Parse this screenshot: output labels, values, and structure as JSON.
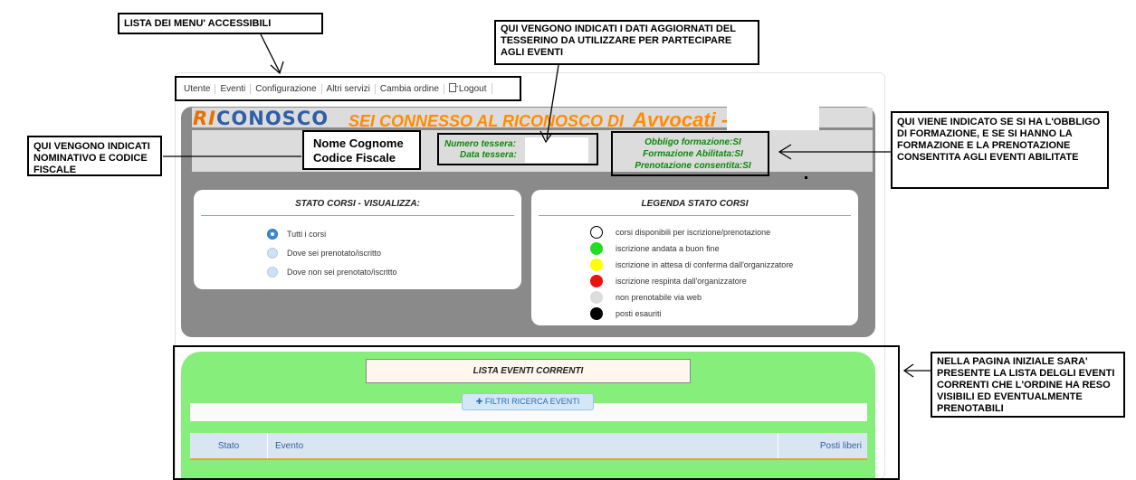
{
  "menu": {
    "items": [
      "Utente",
      "Eventi",
      "Configurazione",
      "Altri servizi",
      "Cambia ordine"
    ],
    "logout": "Logout"
  },
  "header": {
    "logo_ri": "RI",
    "logo_conosco": "CONOSCO",
    "connected_text": "SEI CONNESSO AL RICONOSCO DI",
    "order": "Avvocati -"
  },
  "user": {
    "name": "Nome Cognome",
    "fiscal_code": "Codice Fiscale"
  },
  "tessera": {
    "number_label": "Numero tessera:",
    "date_label": "Data tessera:"
  },
  "obbligo": {
    "line1": "Obbligo formazione:SI",
    "line2": "Formazione Abilitata:SI",
    "line3": "Prenotazione consentita:SI"
  },
  "stato_corsi": {
    "title": "STATO CORSI - VISUALIZZA:",
    "options": [
      "Tutti i corsi",
      "Dove sei prenotato/iscritto",
      "Dove non sei prenotato/iscritto"
    ],
    "selected": "Tutti i corsi"
  },
  "legenda": {
    "title": "LEGENDA STATO CORSI",
    "items": [
      {
        "color": "#ffffff",
        "label": "corsi disponibili per iscrizione/prenotazione"
      },
      {
        "color": "#22dd22",
        "label": "iscrizione andata a buon fine"
      },
      {
        "color": "#ffff00",
        "label": "iscrizione in attesa di conferma dall'organizzatore"
      },
      {
        "color": "#ee1111",
        "label": "iscrizione respinta dall'organizzatore"
      },
      {
        "color": "#dddddd",
        "label": "non prenotabile via web"
      },
      {
        "color": "#000000",
        "label": "posti esauriti"
      }
    ]
  },
  "eventi": {
    "title": "LISTA EVENTI CORRENTI",
    "filter_button": "FILTRI RICERCA EVENTI",
    "columns": [
      "Stato",
      "Evento",
      "Posti liberi"
    ]
  },
  "callouts": {
    "menu": "LISTA DEI MENU' ACCESSIBILI",
    "tessera": "QUI VENGONO INDICATI I DATI AGGIORNATI DEL TESSERINO DA UTILIZZARE PER PARTECIPARE AGLI EVENTI",
    "nominativo": "QUI VENGONO INDICATI NOMINATIVO E CODICE FISCALE",
    "obbligo": "QUI VIENE INDICATO SE SI HA L'OBBLIGO DI FORMAZIONE, E SE SI HANNO LA FORMAZIONE E LA PRENOTAZIONE CONSENTITA AGLI EVENTI ABILITATE",
    "lista": "NELLA PAGINA INIZIALE SARA' PRESENTE LA LISTA DELGLI EVENTI CORRENTI CHE L'ORDINE HA RESO VISIBILI ED EVENTUALMENTE PRENOTABILI"
  }
}
